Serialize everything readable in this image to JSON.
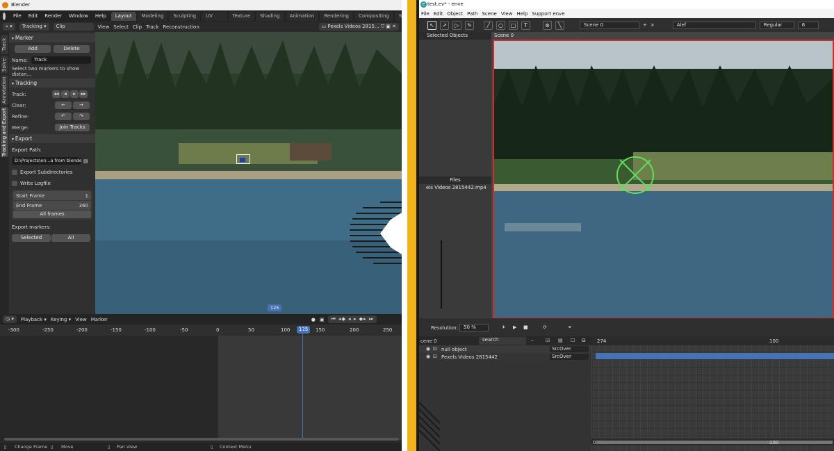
{
  "blender": {
    "title": "Blender",
    "menu": [
      "File",
      "Edit",
      "Render",
      "Window",
      "Help"
    ],
    "workspaces": [
      "Layout",
      "Modeling",
      "Sculpting",
      "UV Editing",
      "Texture Paint",
      "Shading",
      "Animation",
      "Rendering",
      "Compositing",
      "Scripti"
    ],
    "header": {
      "mode": "Tracking",
      "view_mode": "Clip",
      "menus": [
        "View",
        "Select",
        "Clip",
        "Track",
        "Reconstruction"
      ],
      "clip_name": "Pexels Videos 2815..."
    },
    "side_tabs": [
      "Track",
      "Solve",
      "Annotation",
      "Tracking and Export"
    ],
    "marker": {
      "title": "Marker",
      "add": "Add",
      "delete": "Delete",
      "name_label": "Name:",
      "name_value": "Track",
      "hint": "Select two markers to show distan..."
    },
    "tracking": {
      "title": "Tracking",
      "track_label": "Track:",
      "clear_label": "Clear:",
      "refine_label": "Refine:",
      "merge_label": "Merge:",
      "join_tracks": "Join Tracks"
    },
    "export": {
      "title": "Export",
      "path_label": "Export Path:",
      "path_value": "D:\\Projects\\en...a from blender\\",
      "export_subdirs": "Export Subdirectories",
      "write_logfile": "Write Logfile",
      "start_label": "Start Frame",
      "start_value": "1",
      "end_label": "End Frame",
      "end_value": "360",
      "all_frames": "All frames",
      "markers_label": "Export markers:",
      "selected": "Selected",
      "all": "All"
    },
    "frame_marker": "125",
    "timeline": {
      "menus": [
        "Playback",
        "Keying",
        "View",
        "Marker"
      ],
      "ruler": [
        "-300",
        "-250",
        "-200",
        "-150",
        "-100",
        "-50",
        "0",
        "50",
        "100",
        "125",
        "150",
        "200",
        "250"
      ],
      "current": "125"
    },
    "status": [
      "Change Frame",
      "Move",
      "Pan View",
      "Context Menu"
    ]
  },
  "enve": {
    "title": "test.ev* - enve",
    "menu": [
      "File",
      "Edit",
      "Object",
      "Path",
      "Scene",
      "View",
      "Help",
      "Support enve"
    ],
    "scene_field": "Scene 0",
    "font_field": "Alef",
    "style_field": "Regular",
    "size_field": "6",
    "selected_objects": "Selected Objects",
    "files": "Files",
    "file_item": "els Videos 2815442.mp4",
    "viewport_tab": "Scene 0",
    "resolution_label": "Resolution:",
    "resolution_value": "50 %",
    "scene_tree": {
      "scene": "cene 0",
      "search": "search",
      "rows": [
        {
          "name": "null object",
          "blend": "SrcOver"
        },
        {
          "name": "Pexels Videos 2815442",
          "blend": "SrcOver"
        }
      ]
    },
    "timeline_labels": {
      "start": "274",
      "mid": "100",
      "bottom_start": "0",
      "bottom_mid": "100"
    }
  },
  "colors": {
    "accent_blue": "#4772b3",
    "track_green": "#5ee05e",
    "viewport_border": "#c93030",
    "divider_yellow": "#f0b31a"
  }
}
